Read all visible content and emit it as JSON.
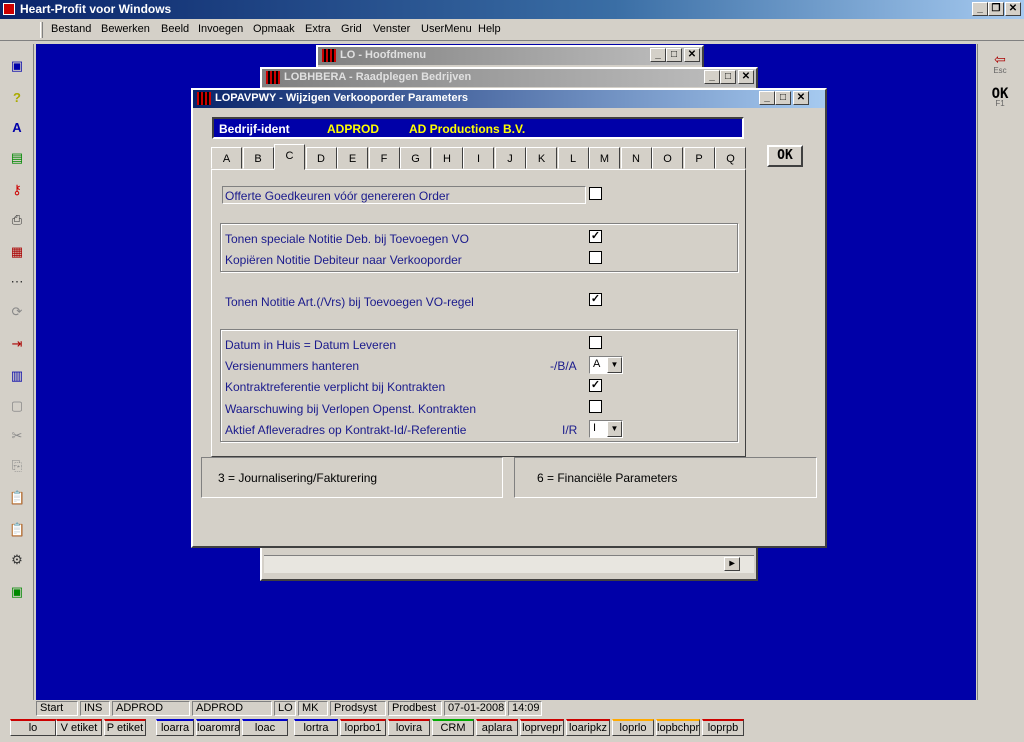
{
  "app": {
    "title": "Heart-Profit voor Windows"
  },
  "menu": [
    "Bestand",
    "Bewerken",
    "Beeld",
    "Invoegen",
    "Opmaak",
    "Extra",
    "Grid",
    "Venster",
    "UserMenu",
    "Help"
  ],
  "windows": {
    "hoofdmenu": {
      "title": "LO - Hoofdmenu"
    },
    "lobhbera": {
      "title": "LOBHBERA - Raadplegen Bedrijven"
    },
    "lopavpwy": {
      "title": "LOPAVPWY - Wijzigen Verkooporder Parameters",
      "bedrijf_label": "Bedrijf-ident",
      "bedrijf_code": "ADPROD",
      "bedrijf_name": "AD Productions B.V.",
      "ok_label": "OK",
      "tabs": [
        "A",
        "B",
        "C",
        "D",
        "E",
        "F",
        "G",
        "H",
        "I",
        "J",
        "K",
        "L",
        "M",
        "N",
        "O",
        "P",
        "Q"
      ],
      "selected_tab": "C",
      "options": {
        "offerte": {
          "label": "Offerte Goedkeuren vóór genereren Order",
          "checked": false
        },
        "tonen_notitie_deb": {
          "label": "Tonen speciale Notitie Deb. bij Toevoegen VO",
          "checked": true
        },
        "kopieren_notitie": {
          "label": "Kopiëren Notitie Debiteur naar Verkooporder",
          "checked": false
        },
        "tonen_notitie_art": {
          "label": "Tonen Notitie Art.(/Vrs) bij Toevoegen VO-regel",
          "checked": true
        },
        "datum_huis": {
          "label": "Datum in Huis = Datum Leveren",
          "checked": false
        },
        "versienummers": {
          "label": "Versienummers hanteren",
          "hint": "-/B/A",
          "value": "A"
        },
        "kontraktref": {
          "label": "Kontraktreferentie verplicht bij Kontrakten",
          "checked": true
        },
        "waarschuwing": {
          "label": "Waarschuwing bij Verlopen Openst. Kontrakten",
          "checked": false
        },
        "aflever": {
          "label": "Aktief Afleveradres op Kontrakt-Id/-Referentie",
          "hint": "I/R",
          "value": "I"
        }
      },
      "footer_left": "3 = Journalisering/Fakturering",
      "footer_right": "6 = Financiële Parameters"
    }
  },
  "right_toolbar": {
    "esc_label": "Esc",
    "ok_label": "OK",
    "f1_label": "F1"
  },
  "status": [
    "Start",
    "INS",
    "ADPROD",
    "ADPROD",
    "LO",
    "MK",
    "Prodsyst",
    "Prodbest",
    "07-01-2008",
    "14:09"
  ],
  "taskbar": [
    "lo",
    "V etiket",
    "P etiket",
    "loarra",
    "loaromra",
    "loac",
    "lortra",
    "loprbo1",
    "lovira",
    "CRM",
    "aplara",
    "loprvepr",
    "loaripkz",
    "loprlo",
    "lopbchpr",
    "loprpb"
  ]
}
